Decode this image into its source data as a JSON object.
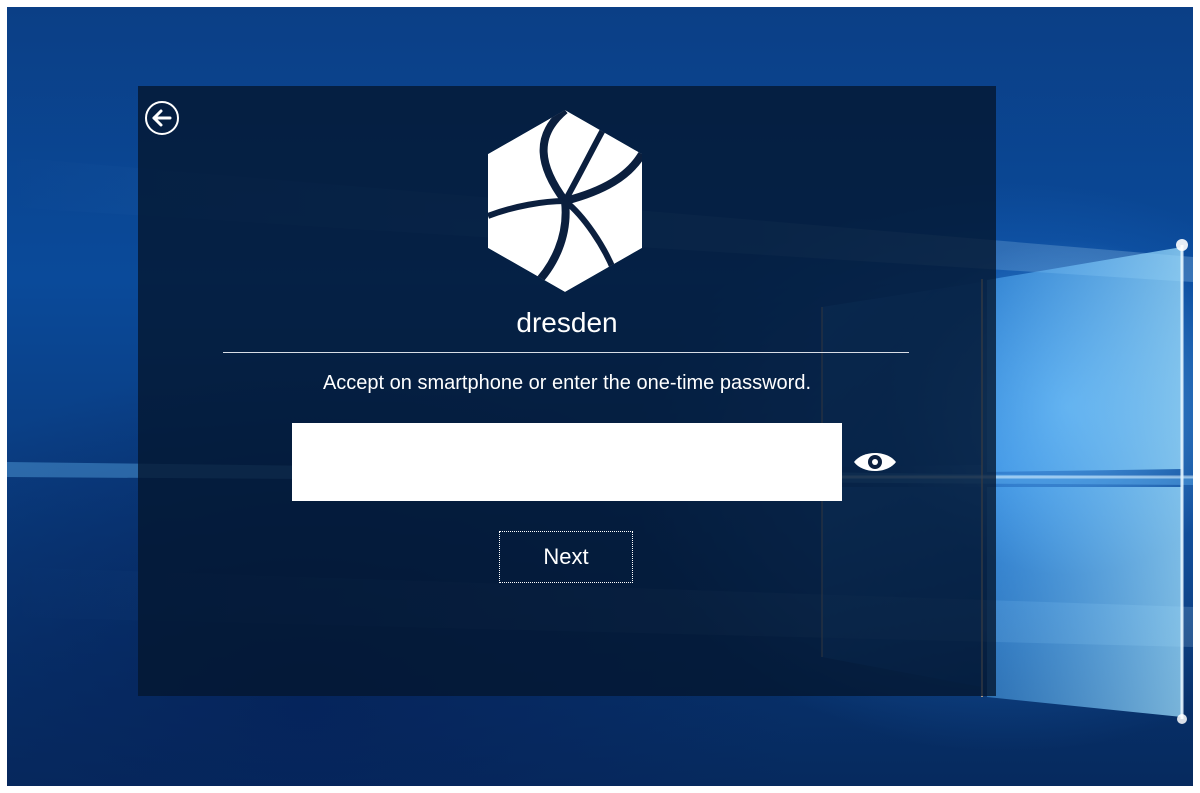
{
  "panel": {
    "brand_name": "dresden",
    "instruction": "Accept on smartphone or enter the one-time password.",
    "otp_field": {
      "value": "",
      "placeholder": ""
    },
    "next_label": "Next"
  },
  "icons": {
    "back": "back-arrow-icon",
    "logo": "dresden-logo-icon",
    "reveal": "eye-icon"
  },
  "colors": {
    "panel_background": "#04162f",
    "text": "#ffffff",
    "desktop_accent": "#1e78d8"
  }
}
